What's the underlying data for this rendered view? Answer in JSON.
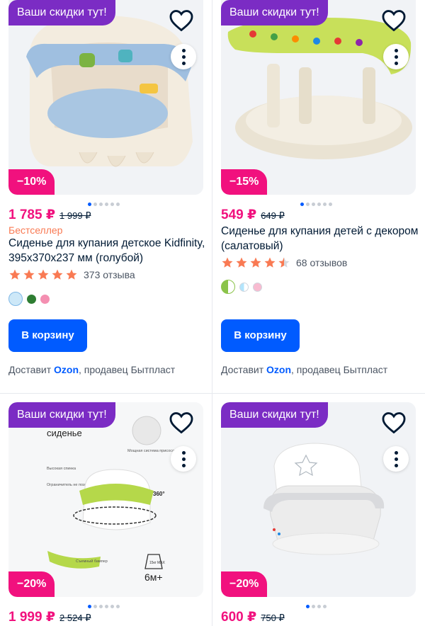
{
  "colors": {
    "accent": "#005bff",
    "price": "#f1117e",
    "promo": "#7b2cc4",
    "bestseller": "#f97a53",
    "star": "#f97a53"
  },
  "products": [
    {
      "promo": "Ваши скидки тут!",
      "discount": "−10%",
      "price": "1 785 ₽",
      "old_price": "1 999 ₽",
      "badge": "Бестселлер",
      "title": "Сиденье для купания детское Kidfinity, 395x370x237 мм (голубой)",
      "stars": 5,
      "reviews": "373 отзыва",
      "swatches": [
        "#cde8f8",
        "#2e7d32",
        "#f48fb1"
      ],
      "cart": "В корзину",
      "delivery_prefix": "Доставит",
      "delivery_brand": "Ozon",
      "delivery_suffix": ", продавец Бытпласт"
    },
    {
      "promo": "Ваши скидки тут!",
      "discount": "−15%",
      "price": "549 ₽",
      "old_price": "649 ₽",
      "title": "Сиденье для купания детей с декором (салатовый)",
      "stars": 4.5,
      "reviews": "68 отзывов",
      "swatches": [
        "#8bc34a",
        "#b3e5fc",
        "#f8bbd0"
      ],
      "cart": "В корзину",
      "delivery_prefix": "Доставит",
      "delivery_brand": "Ozon",
      "delivery_suffix": ", продавец Бытпласт"
    },
    {
      "promo": "Ваши скидки тут!",
      "discount": "−20%",
      "price": "1 999 ₽",
      "old_price": "2 524 ₽",
      "image_texts": {
        "heading": "сиденье",
        "suction": "Мощная система присосок",
        "back": "Высокая спинка",
        "limiter": "Ограничитель не позволит соскользнуть",
        "rotate": "360°",
        "bumper": "Съемный бампер",
        "weight": "15кг MAX",
        "age": "6м+"
      }
    },
    {
      "promo": "Ваши скидки тут!",
      "discount": "−20%",
      "price": "600 ₽",
      "old_price": "750 ₽"
    }
  ]
}
